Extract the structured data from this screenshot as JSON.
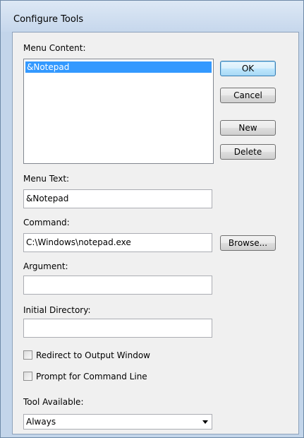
{
  "window": {
    "title": "Configure Tools"
  },
  "menu_content": {
    "label": "Menu Content:",
    "items": [
      "&Notepad"
    ],
    "selected_index": 0
  },
  "buttons": {
    "ok": "OK",
    "cancel": "Cancel",
    "new": "New",
    "delete": "Delete",
    "browse": "Browse..."
  },
  "fields": {
    "menu_text": {
      "label": "Menu Text:",
      "value": "&Notepad"
    },
    "command": {
      "label": "Command:",
      "value": "C:\\Windows\\notepad.exe"
    },
    "argument": {
      "label": "Argument:",
      "value": ""
    },
    "initial_directory": {
      "label": "Initial Directory:",
      "value": ""
    }
  },
  "checkboxes": {
    "redirect_output": {
      "label": "Redirect to Output Window",
      "checked": false
    },
    "prompt_command_line": {
      "label": "Prompt for Command Line",
      "checked": false
    }
  },
  "tool_available": {
    "label": "Tool Available:",
    "selected": "Always"
  },
  "colors": {
    "selection": "#3399ff",
    "window_frame": "#c3d5ea",
    "client_bg": "#f0f0f0"
  }
}
